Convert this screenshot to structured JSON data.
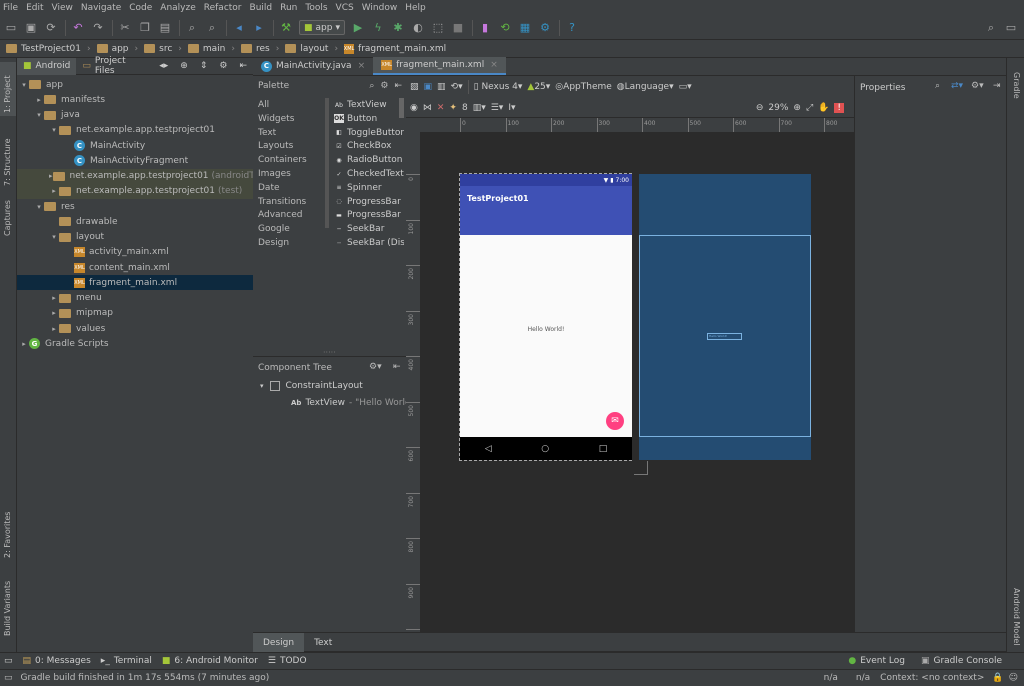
{
  "menu": [
    "File",
    "Edit",
    "View",
    "Navigate",
    "Code",
    "Analyze",
    "Refactor",
    "Build",
    "Run",
    "Tools",
    "VCS",
    "Window",
    "Help"
  ],
  "toolbar": {
    "config": "app"
  },
  "breadcrumb": [
    "TestProject01",
    "app",
    "src",
    "main",
    "res",
    "layout",
    "fragment_main.xml"
  ],
  "left_strip": {
    "project": "1: Project",
    "structure": "7: Structure",
    "captures": "Captures",
    "favorites": "2: Favorites",
    "variants": "Build Variants"
  },
  "right_strip": {
    "gradle": "Gradle",
    "android_model": "Android Model"
  },
  "project_panel": {
    "tab_android": "Android",
    "tab_files": "Project Files"
  },
  "tree": [
    {
      "label": "app",
      "indent": 0,
      "arrow": "▾",
      "icon": "folder"
    },
    {
      "label": "manifests",
      "indent": 1,
      "arrow": "▸",
      "icon": "folder"
    },
    {
      "label": "java",
      "indent": 1,
      "arrow": "▾",
      "icon": "folder"
    },
    {
      "label": "net.example.app.testproject01",
      "indent": 2,
      "arrow": "▾",
      "icon": "folder"
    },
    {
      "label": "MainActivity",
      "indent": 3,
      "arrow": "",
      "icon": "class"
    },
    {
      "label": "MainActivityFragment",
      "indent": 3,
      "arrow": "",
      "icon": "class"
    },
    {
      "label": "net.example.app.testproject01",
      "suffix": "(androidTest)",
      "indent": 2,
      "arrow": "▸",
      "icon": "folder",
      "hl": "green"
    },
    {
      "label": "net.example.app.testproject01",
      "suffix": "(test)",
      "indent": 2,
      "arrow": "▸",
      "icon": "folder",
      "hl": "green"
    },
    {
      "label": "res",
      "indent": 1,
      "arrow": "▾",
      "icon": "folder"
    },
    {
      "label": "drawable",
      "indent": 2,
      "arrow": "",
      "icon": "folder"
    },
    {
      "label": "layout",
      "indent": 2,
      "arrow": "▾",
      "icon": "folder"
    },
    {
      "label": "activity_main.xml",
      "indent": 3,
      "arrow": "",
      "icon": "xml"
    },
    {
      "label": "content_main.xml",
      "indent": 3,
      "arrow": "",
      "icon": "xml"
    },
    {
      "label": "fragment_main.xml",
      "indent": 3,
      "arrow": "",
      "icon": "xml",
      "hl": "blue"
    },
    {
      "label": "menu",
      "indent": 2,
      "arrow": "▸",
      "icon": "folder"
    },
    {
      "label": "mipmap",
      "indent": 2,
      "arrow": "▸",
      "icon": "folder"
    },
    {
      "label": "values",
      "indent": 2,
      "arrow": "▸",
      "icon": "folder"
    },
    {
      "label": "Gradle Scripts",
      "indent": 0,
      "arrow": "▸",
      "icon": "gradle"
    }
  ],
  "editor_tabs": [
    {
      "label": "MainActivity.java",
      "icon": "C",
      "active": false
    },
    {
      "label": "fragment_main.xml",
      "icon": "xml",
      "active": true
    }
  ],
  "palette": {
    "title": "Palette",
    "categories": [
      "All",
      "Widgets",
      "Text",
      "Layouts",
      "Containers",
      "Images",
      "Date",
      "Transitions",
      "Advanced",
      "Google",
      "Design"
    ],
    "items": [
      {
        "label": "TextView",
        "icon": "Ab"
      },
      {
        "label": "Button",
        "icon": "OK"
      },
      {
        "label": "ToggleButton",
        "icon": "◧"
      },
      {
        "label": "CheckBox",
        "icon": "☑"
      },
      {
        "label": "RadioButton",
        "icon": "◉"
      },
      {
        "label": "CheckedTextView",
        "icon": "✓"
      },
      {
        "label": "Spinner",
        "icon": "≡"
      },
      {
        "label": "ProgressBar",
        "icon": "◌"
      },
      {
        "label": "ProgressBar (Horizontal)",
        "icon": "▬"
      },
      {
        "label": "SeekBar",
        "icon": "─"
      },
      {
        "label": "SeekBar (Discrete)",
        "icon": "┄"
      }
    ]
  },
  "component_tree": {
    "title": "Component Tree",
    "root": "ConstraintLayout",
    "child_icon": "Ab",
    "child": "TextView",
    "child_value": "- \"Hello World!\""
  },
  "design_toolbar": {
    "device": "Nexus 4",
    "api": "25",
    "theme": "AppTheme",
    "language": "Language",
    "zoom": "29%"
  },
  "ruler_h": [
    "0",
    "100",
    "200",
    "300",
    "400",
    "500",
    "600",
    "700",
    "800"
  ],
  "ruler_v": [
    "0",
    "100",
    "200",
    "300",
    "400",
    "500",
    "600",
    "700",
    "800",
    "900",
    "1000"
  ],
  "phone": {
    "time": "7:00",
    "app_title": "TestProject01",
    "hello": "Hello World!"
  },
  "blueprint": {
    "label": "Hello World!"
  },
  "properties": {
    "title": "Properties"
  },
  "bottom_tabs": [
    {
      "label": "Design",
      "active": true
    },
    {
      "label": "Text",
      "active": false
    }
  ],
  "tool_windows_left": [
    {
      "label": "0: Messages",
      "icon": "msg"
    },
    {
      "label": "Terminal",
      "icon": "term"
    },
    {
      "label": "6: Android Monitor",
      "icon": "android"
    },
    {
      "label": "TODO",
      "icon": "todo"
    }
  ],
  "tool_windows_right": [
    {
      "label": "Event Log",
      "icon": "log"
    },
    {
      "label": "Gradle Console",
      "icon": "console"
    }
  ],
  "status": {
    "message": "Gradle build finished in 1m 17s 554ms (7 minutes ago)",
    "na1": "n/a",
    "na2": "n/a",
    "context": "Context: <no context>"
  },
  "colors": {
    "bg": "#2b2b2b",
    "panel": "#3c3f41",
    "accent": "#4a88c7",
    "app_bar": "#3f51b5",
    "blueprint": "#244c72",
    "fab": "#ff4081",
    "selection": "#0d293e"
  }
}
